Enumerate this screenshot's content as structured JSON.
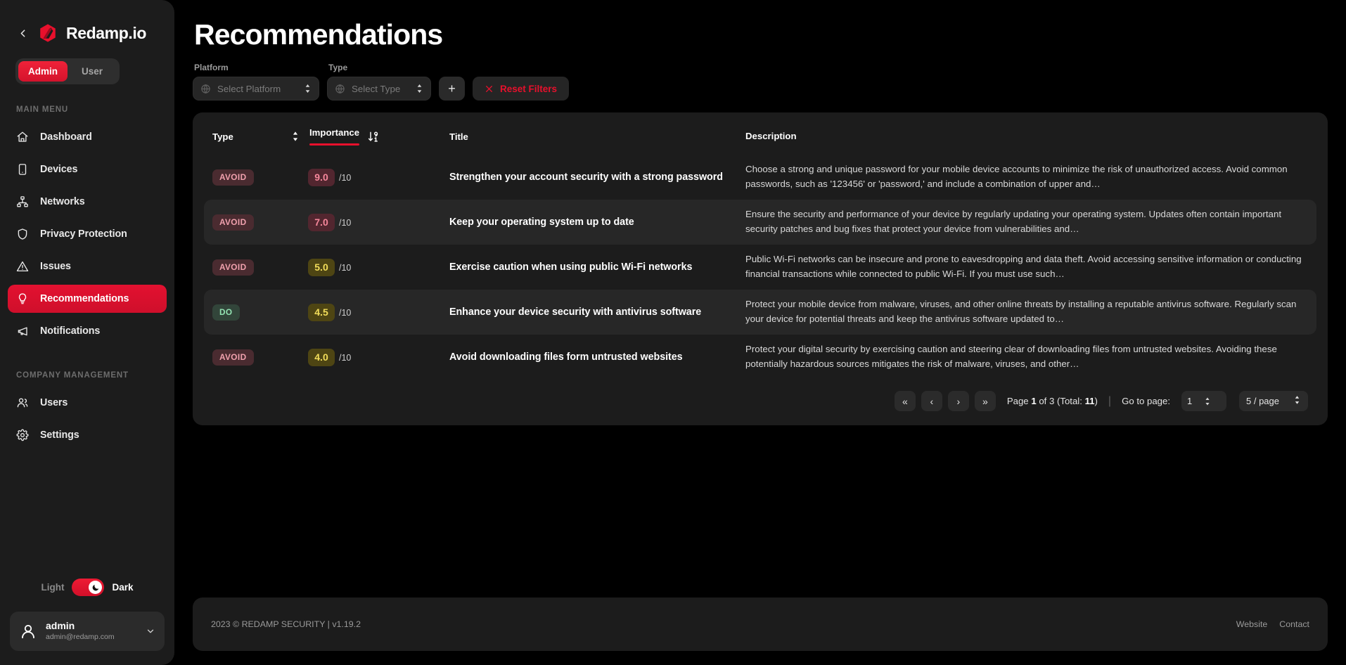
{
  "sidebar": {
    "back_icon": "chevron-left-icon",
    "brand": "Redamp.io",
    "role_toggle": {
      "admin": "Admin",
      "user": "User",
      "active": "Admin"
    },
    "sections": [
      {
        "label": "MAIN MENU",
        "items": [
          {
            "label": "Dashboard",
            "icon": "home-icon",
            "active": false
          },
          {
            "label": "Devices",
            "icon": "device-icon",
            "active": false
          },
          {
            "label": "Networks",
            "icon": "network-icon",
            "active": false
          },
          {
            "label": "Privacy Protection",
            "icon": "shield-icon",
            "active": false
          },
          {
            "label": "Issues",
            "icon": "warning-triangle-icon",
            "active": false
          },
          {
            "label": "Recommendations",
            "icon": "lightbulb-icon",
            "active": true
          },
          {
            "label": "Notifications",
            "icon": "megaphone-icon",
            "active": false
          }
        ]
      },
      {
        "label": "COMPANY MANAGEMENT",
        "items": [
          {
            "label": "Users",
            "icon": "users-icon",
            "active": false
          },
          {
            "label": "Settings",
            "icon": "gear-icon",
            "active": false
          }
        ]
      }
    ],
    "theme": {
      "light": "Light",
      "dark": "Dark",
      "selected": "Dark",
      "icon": "moon-icon"
    },
    "user": {
      "name": "admin",
      "email": "admin@redamp.com",
      "chevron": "chevron-down-icon"
    }
  },
  "main": {
    "title": "Recommendations",
    "filters": {
      "platform": {
        "label": "Platform",
        "placeholder": "Select Platform",
        "value": "",
        "icon": "globe-icon"
      },
      "type": {
        "label": "Type",
        "placeholder": "Select Type",
        "value": "",
        "icon": "globe-icon"
      },
      "add_label": "+",
      "reset_label": "Reset Filters",
      "reset_icon": "close-x-icon"
    },
    "table": {
      "headers": {
        "type": "Type",
        "importance": "Importance",
        "title": "Title",
        "description": "Description"
      },
      "sort": {
        "active_column": "Importance",
        "direction": "desc",
        "type_sort_icon": "sort-updown-icon",
        "importance_sort_icon": "sort-9-to-1-icon"
      },
      "score_suffix": "/10",
      "rows": [
        {
          "type": "AVOID",
          "type_variant": "avoid",
          "score": "9.0",
          "score_variant": "red",
          "title": "Strengthen your account security with a strong password",
          "description": "Choose a strong and unique password for your mobile device accounts to minimize the risk of unauthorized access. Avoid common passwords, such as '123456' or 'password,' and include a combination of upper and…"
        },
        {
          "type": "AVOID",
          "type_variant": "avoid",
          "score": "7.0",
          "score_variant": "red",
          "title": "Keep your operating system up to date",
          "description": "Ensure the security and performance of your device by regularly updating your operating system. Updates often contain important security patches and bug fixes that protect your device from vulnerabilities and…"
        },
        {
          "type": "AVOID",
          "type_variant": "avoid",
          "score": "5.0",
          "score_variant": "amber",
          "title": "Exercise caution when using public Wi-Fi networks",
          "description": "Public Wi-Fi networks can be insecure and prone to eavesdropping and data theft. Avoid accessing sensitive information or conducting financial transactions while connected to public Wi-Fi. If you must use such…"
        },
        {
          "type": "DO",
          "type_variant": "do",
          "score": "4.5",
          "score_variant": "amber",
          "title": "Enhance your device security with antivirus software",
          "description": "Protect your mobile device from malware, viruses, and other online threats by installing a reputable antivirus software. Regularly scan your device for potential threats and keep the antivirus software updated to…"
        },
        {
          "type": "AVOID",
          "type_variant": "avoid",
          "score": "4.0",
          "score_variant": "amber",
          "title": "Avoid downloading files form untrusted websites",
          "description": "Protect your digital security by exercising caution and steering clear of downloading files from untrusted websites. Avoiding these potentially hazardous sources mitigates the risk of malware, viruses, and other…"
        }
      ]
    },
    "pagination": {
      "first_icon": "«",
      "prev_icon": "‹",
      "next_icon": "›",
      "last_icon": "»",
      "page_prefix": "Page ",
      "current_page": "1",
      "of_text": " of 3 (Total: ",
      "total": "11",
      "total_suffix": ")",
      "goto_label": "Go to page:",
      "goto_value": "1",
      "page_size": "5 / page"
    }
  },
  "footer": {
    "copyright": "2023 © REDAMP SECURITY | v1.19.2",
    "links": [
      "Website",
      "Contact"
    ]
  },
  "colors": {
    "accent_red": "#e8102c",
    "sidebar_bg": "#1c1c1c",
    "page_bg": "#000000",
    "row_alt_bg": "#272727",
    "badge_avoid_bg": "#4a2b30",
    "badge_avoid_fg": "#f0a0ad",
    "badge_do_bg": "#32453a",
    "badge_do_fg": "#93e2b2",
    "score_red_bg": "#52262f",
    "score_red_fg": "#f6879b",
    "score_amber_bg": "#4e4513",
    "score_amber_fg": "#f2dd5a"
  }
}
